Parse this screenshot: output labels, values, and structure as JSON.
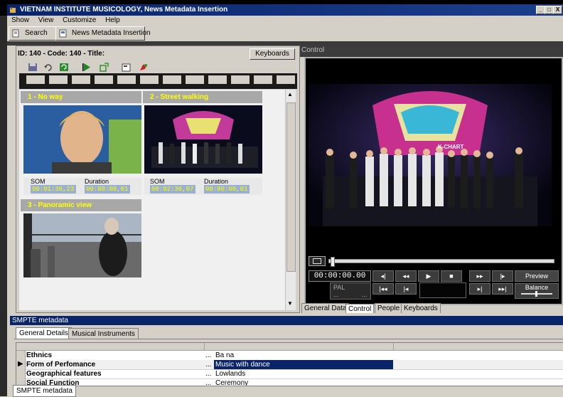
{
  "window": {
    "title": "VIETNAM INSTITUTE MUSICOLOGY, News Metadata Insertion",
    "controls": [
      "_",
      "□",
      "X"
    ]
  },
  "menu": [
    "Show",
    "View",
    "Customize",
    "Help"
  ],
  "topbar": {
    "search_label": "Search",
    "news_label": "News Metadata Insertion"
  },
  "editor": {
    "info": "ID: 140  -  Code: 140  -  Title:",
    "keyboards_label": "Keyboards"
  },
  "clips": [
    {
      "title": "1 -  No way",
      "som_label": "SOM",
      "duration_label": "Duration",
      "som": "00:01:36,23",
      "duration": "00:00:00,01"
    },
    {
      "title": "2 -  Street walking",
      "som_label": "SOM",
      "duration_label": "Duration",
      "som": "00:02:36,07",
      "duration": "00:00:00,01"
    },
    {
      "title": "3 -  Panoramic view"
    }
  ],
  "player": {
    "panel_label": "Control",
    "timecode": "00:00:00.00",
    "format": "PAL",
    "format_sub": "...             ...",
    "preview_label": "Preview",
    "balance_label": "Balance",
    "stage_text": "K-CHART"
  },
  "right_tabs": [
    "General Data",
    "Control",
    "People",
    "Keyboards"
  ],
  "smpte": {
    "header": "SMPTE metadata",
    "tabs": [
      "General Details",
      "Musical Instruments"
    ],
    "rows": [
      {
        "name": "Ethnics",
        "dots": "...",
        "value": "Ba na"
      },
      {
        "name": "Form of Perfomance",
        "dots": "...",
        "value": "Music with dance"
      },
      {
        "name": "Geographical features",
        "dots": "...",
        "value": "Lowlands"
      },
      {
        "name": "Social Function",
        "dots": "...",
        "value": "Ceremony"
      }
    ],
    "bottom_tab": "SMPTE metadata"
  },
  "colors": {
    "titlebar": "#0a246a",
    "clip_header": "#a8a8a8",
    "clip_title": "#ffff00",
    "selected_row": "#0a246a"
  }
}
